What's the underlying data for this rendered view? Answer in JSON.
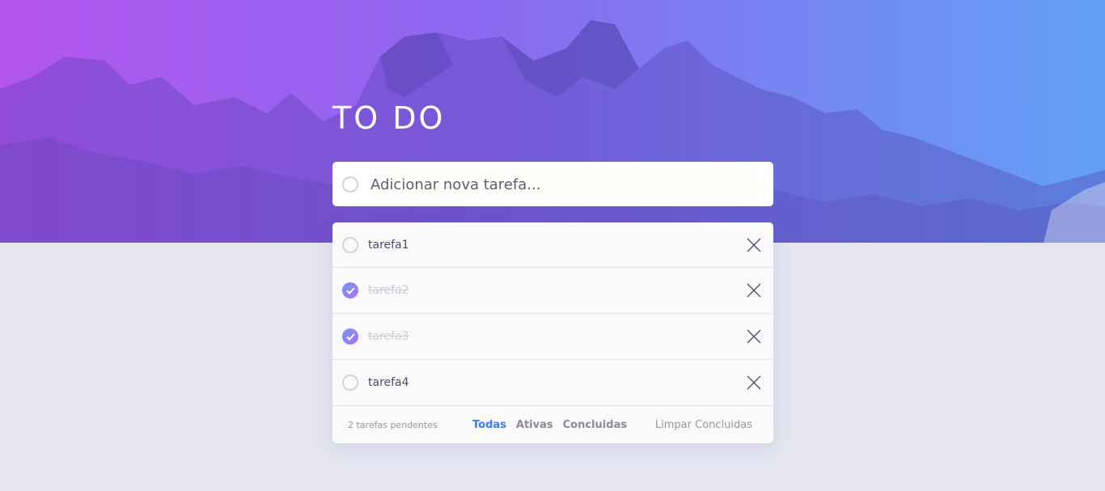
{
  "app": {
    "title": "TO DO"
  },
  "new_task": {
    "placeholder": "Adicionar nova tarefa..."
  },
  "tasks": [
    {
      "label": "tarefa1",
      "completed": false
    },
    {
      "label": "tarefa2",
      "completed": true
    },
    {
      "label": "tarefa3",
      "completed": true
    },
    {
      "label": "tarefa4",
      "completed": false
    }
  ],
  "footer": {
    "pending_count": "2 tarefas pendentes",
    "filters": [
      "Todas",
      "Ativas",
      "Concluidas"
    ],
    "active_filter": "Todas",
    "clear_label": "Limpar Concluidas"
  },
  "colors": {
    "accent": "#3a7bfd",
    "gradient_start": "#b455f0",
    "gradient_end": "#63a0f5",
    "background": "#e4e5f1"
  },
  "icons": {
    "complete": "check-icon",
    "delete": "close-icon"
  }
}
